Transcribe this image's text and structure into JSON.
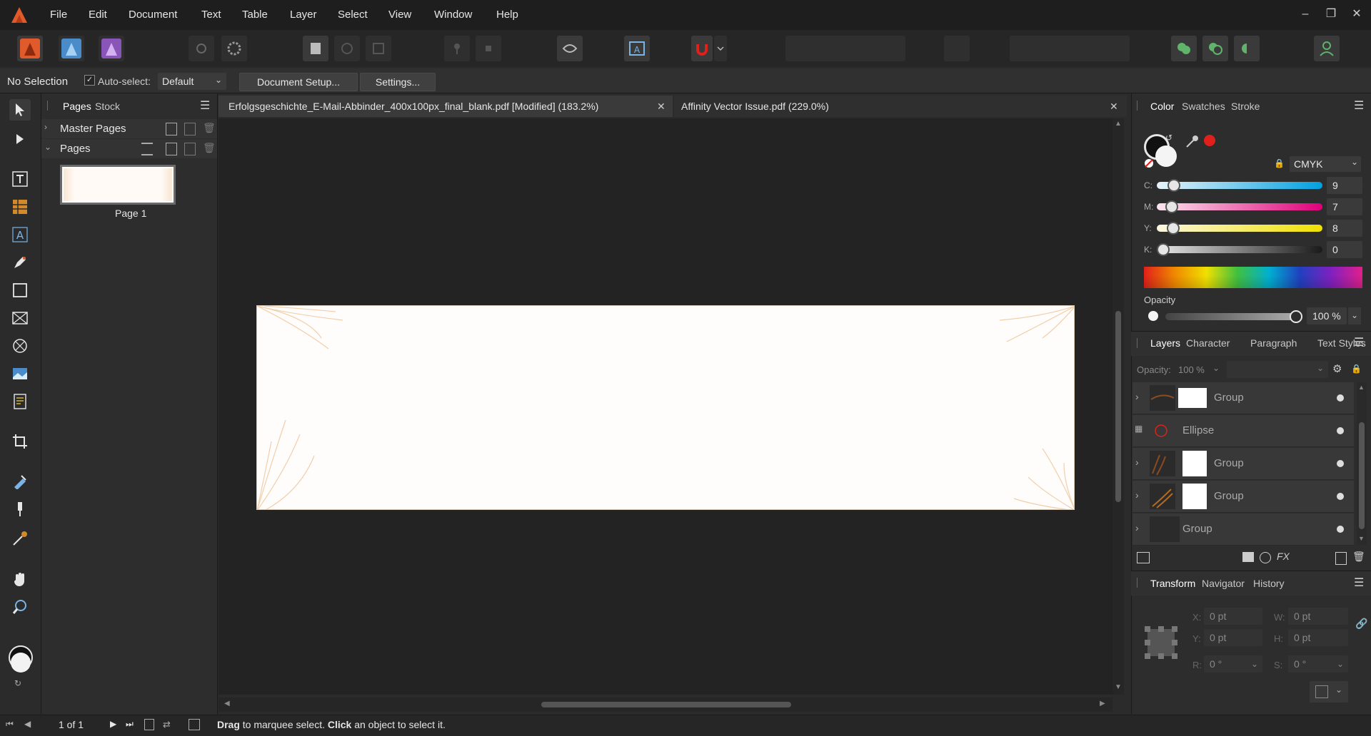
{
  "menu": [
    "File",
    "Edit",
    "Document",
    "Text",
    "Table",
    "Layer",
    "Select",
    "View",
    "Window",
    "Help"
  ],
  "context": {
    "selection": "No Selection",
    "auto_select_label": "Auto-select:",
    "auto_select_value": "Default",
    "document_setup": "Document Setup...",
    "settings": "Settings..."
  },
  "pages_panel": {
    "tabs": [
      "Pages",
      "Stock"
    ],
    "master_pages": "Master Pages",
    "pages": "Pages",
    "page1": "Page 1"
  },
  "doc_tabs": [
    "Erfolgsgeschichte_E-Mail-Abbinder_400x100px_final_blank.pdf [Modified] (183.2%)",
    "Affinity Vector Issue.pdf (229.0%)"
  ],
  "color_panel": {
    "tabs": [
      "Color",
      "Swatches",
      "Stroke"
    ],
    "model": "CMYK",
    "channels": [
      {
        "label": "C:",
        "value": "9"
      },
      {
        "label": "M:",
        "value": "7"
      },
      {
        "label": "Y:",
        "value": "8"
      },
      {
        "label": "K:",
        "value": "0"
      }
    ],
    "opacity_label": "Opacity",
    "opacity_value": "100 %",
    "fill_color": "#ffffff",
    "stroke_color": "#000000",
    "accent_red": "#e0201a"
  },
  "layers_panel": {
    "tabs": [
      "Layers",
      "Character",
      "Paragraph",
      "Text Styles"
    ],
    "opacity_label": "Opacity:",
    "opacity_value": "100 %",
    "rows": [
      "Group",
      "Ellipse",
      "Group",
      "Group",
      "Group"
    ]
  },
  "transform_panel": {
    "tabs": [
      "Transform",
      "Navigator",
      "History"
    ],
    "x_label": "X:",
    "x_value": "0 pt",
    "y_label": "Y:",
    "y_value": "0 pt",
    "w_label": "W:",
    "w_value": "0 pt",
    "h_label": "H:",
    "h_value": "0 pt",
    "r_label": "R:",
    "r_value": "0 °",
    "s_label": "S:",
    "s_value": "0 °"
  },
  "status": {
    "page_count": "1 of 1",
    "hint_drag": "Drag",
    "hint_mid": " to marquee select. ",
    "hint_click": "Click",
    "hint_end": " an object to select it."
  }
}
